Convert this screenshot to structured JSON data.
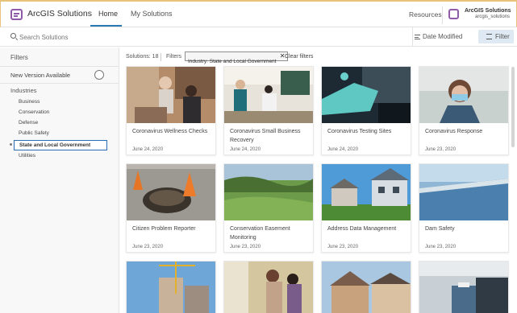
{
  "header": {
    "app_title": "ArcGIS Solutions",
    "tabs": [
      {
        "label": "Home"
      },
      {
        "label": "My Solutions"
      }
    ],
    "resources_label": "Resources",
    "user_org": "ArcGIS Solutions",
    "user_handle": "arcgis_solutions"
  },
  "search": {
    "placeholder": "Search Solutions",
    "sort_label": "Date Modified",
    "filter_label": "Filter"
  },
  "sidebar": {
    "heading": "Filters",
    "new_version_label": "New Version Available",
    "industries_label": "Industries",
    "items": [
      {
        "label": "Business"
      },
      {
        "label": "Conservation"
      },
      {
        "label": "Defense"
      },
      {
        "label": "Public Safety"
      },
      {
        "label": "State and Local Government"
      },
      {
        "label": "Utilities"
      }
    ],
    "selected_item": "State and Local Government"
  },
  "toolbar": {
    "count_text": "Solutions: 18",
    "filters_label": "Filters",
    "chip_label": "Industry: State and Local Government",
    "clear_label": "Clear filters"
  },
  "cards": [
    {
      "title": "Coronavirus Wellness Checks",
      "date": "June 24, 2020"
    },
    {
      "title": "Coronavirus Small Business Recovery",
      "date": "June 24, 2020"
    },
    {
      "title": "Coronavirus Testing Sites",
      "date": "June 24, 2020"
    },
    {
      "title": "Coronavirus Response",
      "date": "June 23, 2020"
    },
    {
      "title": "Citizen Problem Reporter",
      "date": "June 23, 2020"
    },
    {
      "title": "Conservation Easement Monitoring",
      "date": "June 23, 2020"
    },
    {
      "title": "Address Data Management",
      "date": "June 23, 2020"
    },
    {
      "title": "Dam Safety",
      "date": "June 23, 2020"
    },
    {
      "title": "",
      "date": ""
    },
    {
      "title": "",
      "date": ""
    },
    {
      "title": "",
      "date": ""
    },
    {
      "title": "",
      "date": ""
    }
  ],
  "colors": {
    "accent": "#2a7ab8",
    "brand": "#8f5aa8",
    "filter_button_bg": "#dfe9f3"
  }
}
